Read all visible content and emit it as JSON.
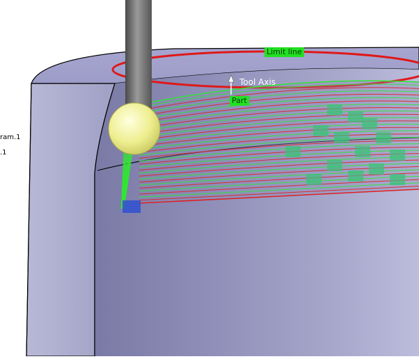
{
  "tree": {
    "item1": "ram.1",
    "item2": ".1"
  },
  "viewport": {
    "limit_line_label": "Limit line",
    "tool_axis_label": "Tool Axis",
    "part_label": "Part"
  },
  "colors": {
    "cylinder_face": "#9a9ac4",
    "limit_line": "#e01818",
    "toolpath_green": "#2ee82e",
    "toolpath_red": "#e02020",
    "tool_shank": "#6a6a6a",
    "tool_ball": "#f2f2a0",
    "tag_green": "#22e022"
  }
}
